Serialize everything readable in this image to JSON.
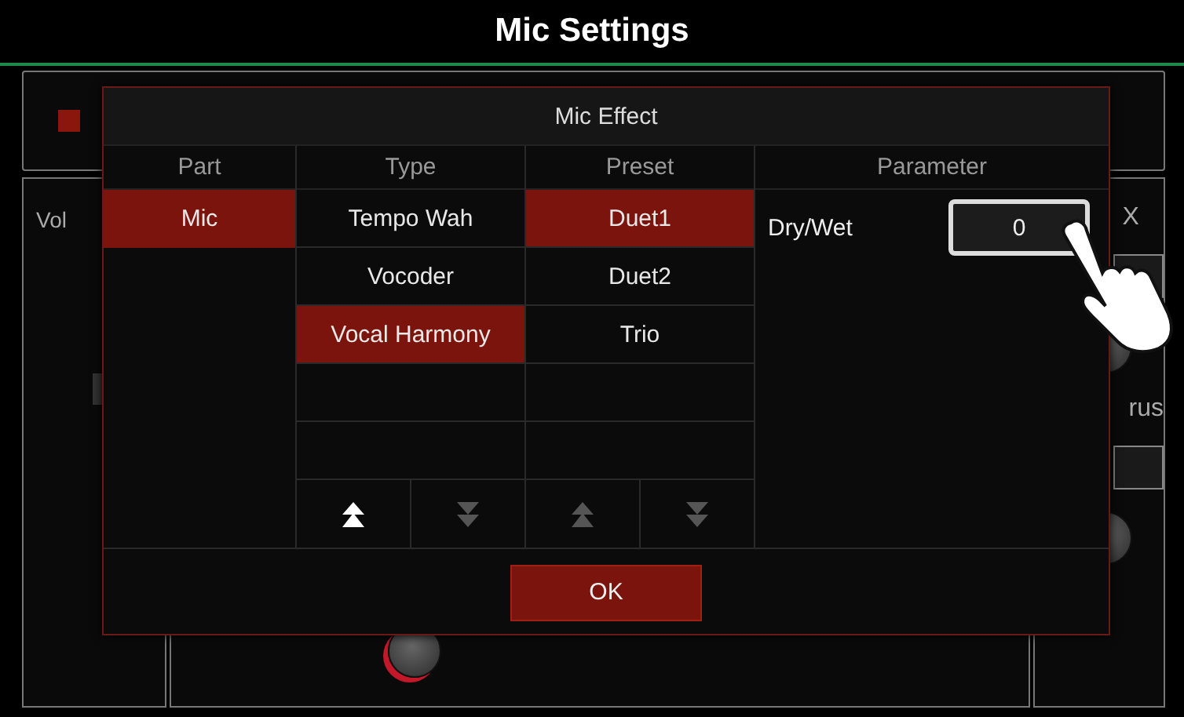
{
  "window": {
    "title": "Mic Settings"
  },
  "mic_checkbox": {
    "checked": true
  },
  "left_panel_label": "Vol",
  "right_panel_labels": [
    "X",
    "rus"
  ],
  "dialog": {
    "title": "Mic Effect",
    "columns": [
      "Part",
      "Type",
      "Preset",
      "Parameter"
    ],
    "parts": [
      {
        "label": "Mic",
        "selected": true
      }
    ],
    "types": [
      {
        "label": "Tempo Wah",
        "selected": false
      },
      {
        "label": "Vocoder",
        "selected": false
      },
      {
        "label": "Vocal Harmony",
        "selected": true
      }
    ],
    "presets": [
      {
        "label": "Duet1",
        "selected": true
      },
      {
        "label": "Duet2",
        "selected": false
      },
      {
        "label": "Trio",
        "selected": false
      }
    ],
    "type_scroll": {
      "up_enabled": true,
      "down_enabled": false
    },
    "preset_scroll": {
      "up_enabled": false,
      "down_enabled": false
    },
    "parameters": [
      {
        "name": "Dry/Wet",
        "value": "0",
        "highlighted": true
      }
    ],
    "ok": "OK"
  }
}
